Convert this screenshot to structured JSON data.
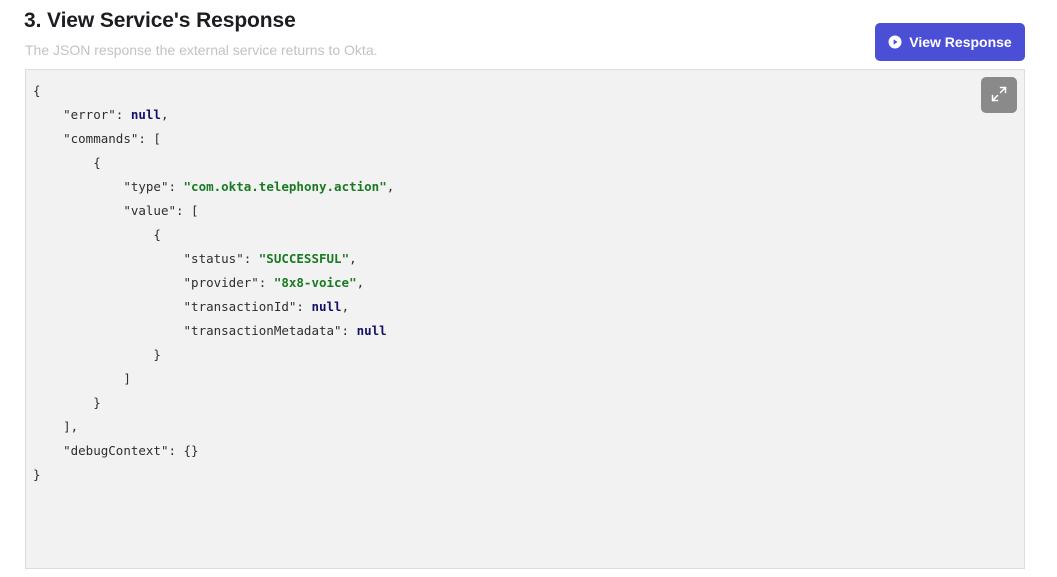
{
  "header": {
    "title": "3. View Service's Response",
    "subtitle": "The JSON response the external service returns to Okta.",
    "view_button_label": "View Response",
    "view_button_icon": "play-circle-icon",
    "accent_color": "#4b4fd6"
  },
  "code_panel": {
    "expand_icon": "expand-icon",
    "lines": [
      {
        "indent": 0,
        "tokens": [
          {
            "t": "p",
            "v": "{"
          }
        ]
      },
      {
        "indent": 1,
        "tokens": [
          {
            "t": "p",
            "v": "\"error\": "
          },
          {
            "t": "kw",
            "v": "null"
          },
          {
            "t": "p",
            "v": ","
          }
        ]
      },
      {
        "indent": 1,
        "tokens": [
          {
            "t": "p",
            "v": "\"commands\": ["
          }
        ]
      },
      {
        "indent": 2,
        "tokens": [
          {
            "t": "p",
            "v": "{"
          }
        ]
      },
      {
        "indent": 3,
        "tokens": [
          {
            "t": "p",
            "v": "\"type\": "
          },
          {
            "t": "str",
            "v": "\"com.okta.telephony.action\""
          },
          {
            "t": "p",
            "v": ","
          }
        ]
      },
      {
        "indent": 3,
        "tokens": [
          {
            "t": "p",
            "v": "\"value\": ["
          }
        ]
      },
      {
        "indent": 4,
        "tokens": [
          {
            "t": "p",
            "v": "{"
          }
        ]
      },
      {
        "indent": 5,
        "tokens": [
          {
            "t": "p",
            "v": "\"status\": "
          },
          {
            "t": "str",
            "v": "\"SUCCESSFUL\""
          },
          {
            "t": "p",
            "v": ","
          }
        ]
      },
      {
        "indent": 5,
        "tokens": [
          {
            "t": "p",
            "v": "\"provider\": "
          },
          {
            "t": "str",
            "v": "\"8x8-voice\""
          },
          {
            "t": "p",
            "v": ","
          }
        ]
      },
      {
        "indent": 5,
        "tokens": [
          {
            "t": "p",
            "v": "\"transactionId\": "
          },
          {
            "t": "kw",
            "v": "null"
          },
          {
            "t": "p",
            "v": ","
          }
        ]
      },
      {
        "indent": 5,
        "tokens": [
          {
            "t": "p",
            "v": "\"transactionMetadata\": "
          },
          {
            "t": "kw",
            "v": "null"
          }
        ]
      },
      {
        "indent": 4,
        "tokens": [
          {
            "t": "p",
            "v": "}"
          }
        ]
      },
      {
        "indent": 3,
        "tokens": [
          {
            "t": "p",
            "v": "]"
          }
        ]
      },
      {
        "indent": 2,
        "tokens": [
          {
            "t": "p",
            "v": "}"
          }
        ]
      },
      {
        "indent": 1,
        "tokens": [
          {
            "t": "p",
            "v": "],"
          }
        ]
      },
      {
        "indent": 1,
        "tokens": [
          {
            "t": "p",
            "v": "\"debugContext\": {}"
          }
        ]
      },
      {
        "indent": 0,
        "tokens": [
          {
            "t": "p",
            "v": "}"
          }
        ]
      }
    ]
  }
}
